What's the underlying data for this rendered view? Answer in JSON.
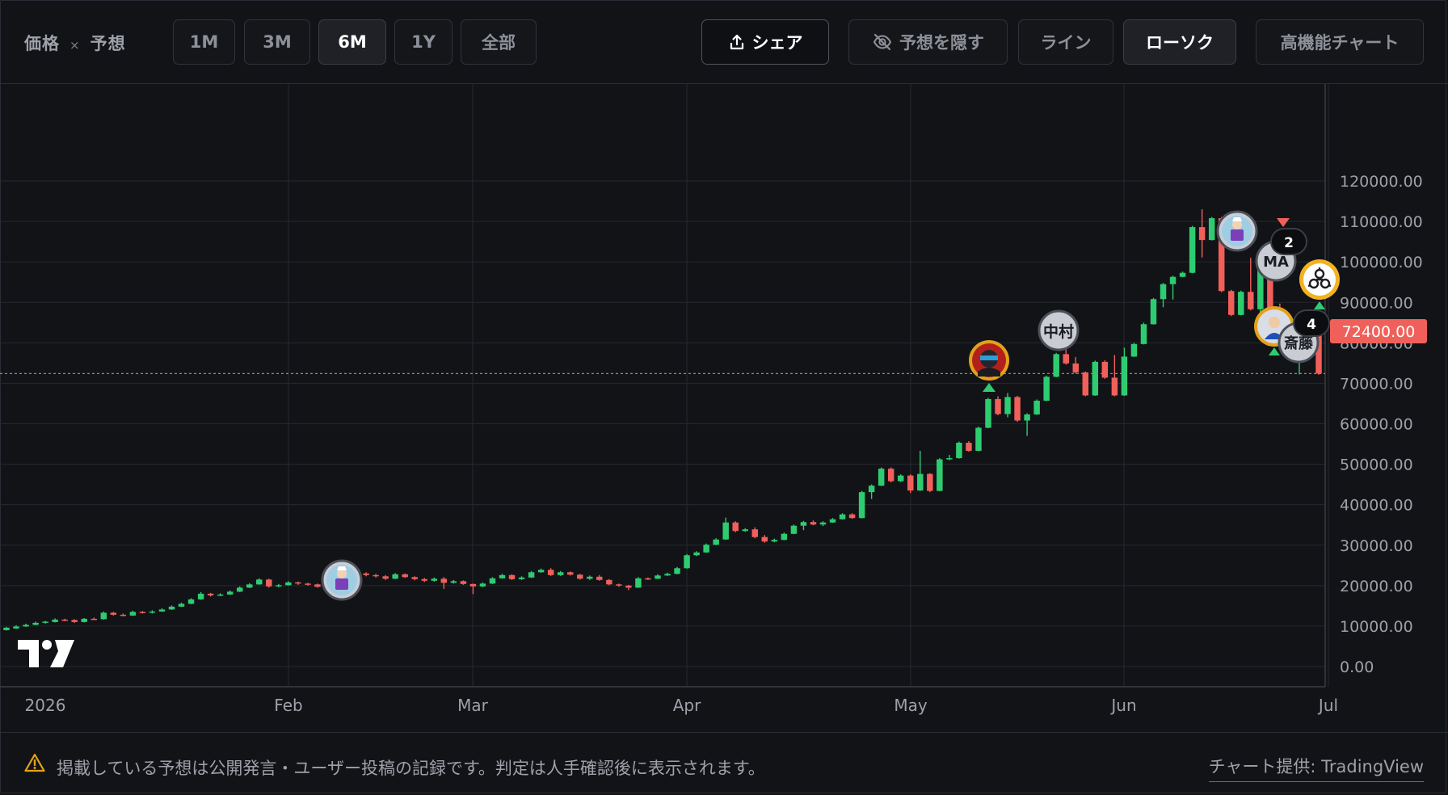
{
  "toolbar": {
    "title_price": "価格",
    "title_sep": "×",
    "title_forecast": "予想",
    "ranges": [
      "1M",
      "3M",
      "6M",
      "1Y",
      "全部"
    ],
    "active_range": "6M",
    "share_label": "シェア",
    "hide_forecast_label": "予想を隠す",
    "line_label": "ライン",
    "candle_label": "ローソク",
    "advanced_label": "高機能チャート"
  },
  "footer": {
    "disclaimer": "掲載している予想は公開発言・ユーザー投稿の記録です。判定は人手確認後に表示されます。",
    "credit": "チャート提供: TradingView"
  },
  "colors": {
    "background": "#121317",
    "up": "#2ecc71",
    "down": "#f0605a",
    "grid": "#262830",
    "price_line": "#f0605a"
  },
  "icons": [
    "share-icon",
    "eye-off-icon",
    "warning-icon",
    "tradingview-logo"
  ],
  "chart_data": {
    "type": "candlestick",
    "x_ticks": [
      "2026",
      "Feb",
      "Mar",
      "Apr",
      "May",
      "Jun",
      "Jul"
    ],
    "y_ticks": [
      "120000.00",
      "110000.00",
      "100000.00",
      "90000.00",
      "80000.00",
      "70000.00",
      "60000.00",
      "50000.00",
      "40000.00",
      "30000.00",
      "20000.00",
      "10000.00",
      "0.00"
    ],
    "ylim": [
      0,
      120000
    ],
    "current_price": 72400,
    "current_price_label": "72400.00",
    "grid": true,
    "candles": [
      [
        9000,
        9600,
        9800,
        8900
      ],
      [
        9400,
        9900,
        10200,
        9300
      ],
      [
        9900,
        10300,
        10600,
        9800
      ],
      [
        10300,
        10800,
        11100,
        10200
      ],
      [
        10800,
        11100,
        11300,
        10600
      ],
      [
        11000,
        11600,
        11900,
        10900
      ],
      [
        11600,
        11500,
        11800,
        11200
      ],
      [
        11500,
        11000,
        11700,
        10800
      ],
      [
        11000,
        11800,
        12000,
        10900
      ],
      [
        11800,
        11700,
        12100,
        11500
      ],
      [
        11700,
        13300,
        13600,
        11600
      ],
      [
        13300,
        12800,
        13500,
        12600
      ],
      [
        12800,
        12600,
        13100,
        12400
      ],
      [
        12600,
        13500,
        13800,
        12500
      ],
      [
        13500,
        13300,
        13700,
        13100
      ],
      [
        13300,
        13600,
        13900,
        13100
      ],
      [
        13600,
        14100,
        14400,
        13500
      ],
      [
        14100,
        14800,
        15100,
        14000
      ],
      [
        14800,
        15500,
        15800,
        14700
      ],
      [
        15500,
        16600,
        16900,
        15400
      ],
      [
        16600,
        18000,
        18400,
        16500
      ],
      [
        18000,
        17600,
        18200,
        17300
      ],
      [
        17600,
        17800,
        18100,
        17400
      ],
      [
        17800,
        18500,
        18800,
        17700
      ],
      [
        18500,
        19500,
        19800,
        18400
      ],
      [
        19500,
        20300,
        20600,
        19400
      ],
      [
        20300,
        21500,
        21800,
        20200
      ],
      [
        21500,
        19800,
        21700,
        19500
      ],
      [
        19800,
        20100,
        20400,
        19600
      ],
      [
        20100,
        20800,
        21100,
        20000
      ],
      [
        20800,
        20500,
        21000,
        20200
      ],
      [
        20500,
        20300,
        20700,
        20000
      ],
      [
        20300,
        19700,
        20500,
        19500
      ],
      [
        19700,
        21200,
        21500,
        19600
      ],
      [
        21200,
        22400,
        22700,
        21100
      ],
      [
        22400,
        24100,
        24500,
        22300
      ],
      [
        24100,
        23000,
        24300,
        22700
      ],
      [
        23000,
        22600,
        23300,
        22300
      ],
      [
        22600,
        22300,
        22900,
        22000
      ],
      [
        22300,
        21700,
        22600,
        21400
      ],
      [
        21700,
        22800,
        23100,
        21600
      ],
      [
        22800,
        22100,
        23000,
        21900
      ],
      [
        22100,
        21600,
        22300,
        21300
      ],
      [
        21600,
        21200,
        21900,
        20900
      ],
      [
        21200,
        21700,
        22000,
        21000
      ],
      [
        21700,
        20700,
        22100,
        19200
      ],
      [
        20700,
        21100,
        21400,
        20500
      ],
      [
        21100,
        20400,
        21300,
        20200
      ],
      [
        20400,
        19800,
        20500,
        17900
      ],
      [
        19800,
        20500,
        20800,
        19600
      ],
      [
        20500,
        21800,
        22100,
        20400
      ],
      [
        21800,
        22600,
        22900,
        21700
      ],
      [
        22600,
        21600,
        22800,
        21400
      ],
      [
        21600,
        22000,
        22300,
        21400
      ],
      [
        22000,
        23300,
        23600,
        21900
      ],
      [
        23300,
        23900,
        24200,
        23200
      ],
      [
        23900,
        22600,
        24300,
        22400
      ],
      [
        22600,
        23300,
        23600,
        22400
      ],
      [
        23300,
        22700,
        23500,
        22500
      ],
      [
        22700,
        21700,
        22900,
        21500
      ],
      [
        21700,
        22200,
        22500,
        21400
      ],
      [
        22200,
        21400,
        22600,
        21200
      ],
      [
        21400,
        20300,
        21600,
        20100
      ],
      [
        20300,
        20000,
        20500,
        19700
      ],
      [
        20000,
        19500,
        20200,
        18900
      ],
      [
        19500,
        21800,
        22100,
        19400
      ],
      [
        21800,
        21700,
        22000,
        21400
      ],
      [
        21700,
        22500,
        22800,
        21600
      ],
      [
        22500,
        22900,
        23200,
        22400
      ],
      [
        22900,
        24300,
        24600,
        22800
      ],
      [
        24300,
        27500,
        27800,
        24200
      ],
      [
        27500,
        28200,
        28500,
        27300
      ],
      [
        28200,
        30100,
        30400,
        28100
      ],
      [
        30100,
        31400,
        31700,
        30000
      ],
      [
        31400,
        35600,
        36800,
        31300
      ],
      [
        35600,
        33500,
        35900,
        33200
      ],
      [
        33500,
        33900,
        34200,
        33300
      ],
      [
        33900,
        32000,
        34400,
        31700
      ],
      [
        32000,
        30900,
        32500,
        30600
      ],
      [
        30900,
        31300,
        31600,
        30700
      ],
      [
        31300,
        32800,
        33100,
        31200
      ],
      [
        32800,
        34800,
        35100,
        32700
      ],
      [
        34800,
        35700,
        36000,
        33700
      ],
      [
        35700,
        35100,
        36100,
        34900
      ],
      [
        35100,
        35600,
        35900,
        34700
      ],
      [
        35600,
        36400,
        36700,
        35500
      ],
      [
        36400,
        37600,
        37900,
        36300
      ],
      [
        37600,
        36700,
        37900,
        36500
      ],
      [
        36700,
        43100,
        43400,
        36600
      ],
      [
        43100,
        44700,
        45000,
        41400
      ],
      [
        44700,
        48900,
        49200,
        44600
      ],
      [
        48900,
        45800,
        49200,
        45500
      ],
      [
        45800,
        47200,
        47500,
        45600
      ],
      [
        47200,
        43500,
        47500,
        42900
      ],
      [
        43500,
        47600,
        53300,
        43400
      ],
      [
        47600,
        43400,
        47800,
        43100
      ],
      [
        43400,
        51200,
        51500,
        43300
      ],
      [
        51200,
        51500,
        52300,
        51000
      ],
      [
        51500,
        55300,
        55600,
        51400
      ],
      [
        55300,
        53300,
        55700,
        53100
      ],
      [
        53300,
        59000,
        59300,
        53200
      ],
      [
        59000,
        66100,
        66400,
        58900
      ],
      [
        66100,
        62400,
        66800,
        62100
      ],
      [
        62400,
        66600,
        67600,
        61600
      ],
      [
        66600,
        60800,
        66900,
        60500
      ],
      [
        60800,
        62300,
        62600,
        57000
      ],
      [
        62300,
        65700,
        66000,
        62200
      ],
      [
        65700,
        71600,
        71900,
        65600
      ],
      [
        71600,
        77200,
        77500,
        71500
      ],
      [
        77200,
        74900,
        82400,
        74600
      ],
      [
        74900,
        72700,
        76500,
        72400
      ],
      [
        72700,
        67000,
        72900,
        66800
      ],
      [
        67000,
        75300,
        75600,
        66900
      ],
      [
        75300,
        71400,
        75700,
        71100
      ],
      [
        71400,
        67000,
        77000,
        66800
      ],
      [
        67000,
        76600,
        78800,
        66900
      ],
      [
        76600,
        79700,
        80000,
        76500
      ],
      [
        79700,
        84600,
        85000,
        79600
      ],
      [
        84600,
        90800,
        91100,
        84500
      ],
      [
        90800,
        94500,
        94800,
        88800
      ],
      [
        94500,
        96300,
        96600,
        90700
      ],
      [
        96300,
        97300,
        97600,
        96200
      ],
      [
        97300,
        108600,
        108900,
        97200
      ],
      [
        108600,
        105400,
        113000,
        101100
      ],
      [
        105400,
        110800,
        111100,
        105300
      ],
      [
        110800,
        92800,
        111100,
        92500
      ],
      [
        92800,
        86900,
        93100,
        86600
      ],
      [
        86900,
        92600,
        92900,
        86800
      ],
      [
        92600,
        88300,
        101000,
        88000
      ],
      [
        88300,
        98100,
        98400,
        84500
      ],
      [
        98100,
        88000,
        101900,
        87700
      ],
      [
        88000,
        80500,
        89700,
        79400
      ],
      [
        80500,
        77100,
        80900,
        76800
      ],
      [
        77100,
        78600,
        79400,
        72200
      ],
      [
        78600,
        82100,
        82400,
        78500
      ],
      [
        82100,
        72400,
        82500,
        72100
      ]
    ]
  },
  "markers": {
    "nakamura": "中村",
    "ma": "MA",
    "saito": "斎藤",
    "badge_2": "2",
    "badge_4": "4"
  }
}
